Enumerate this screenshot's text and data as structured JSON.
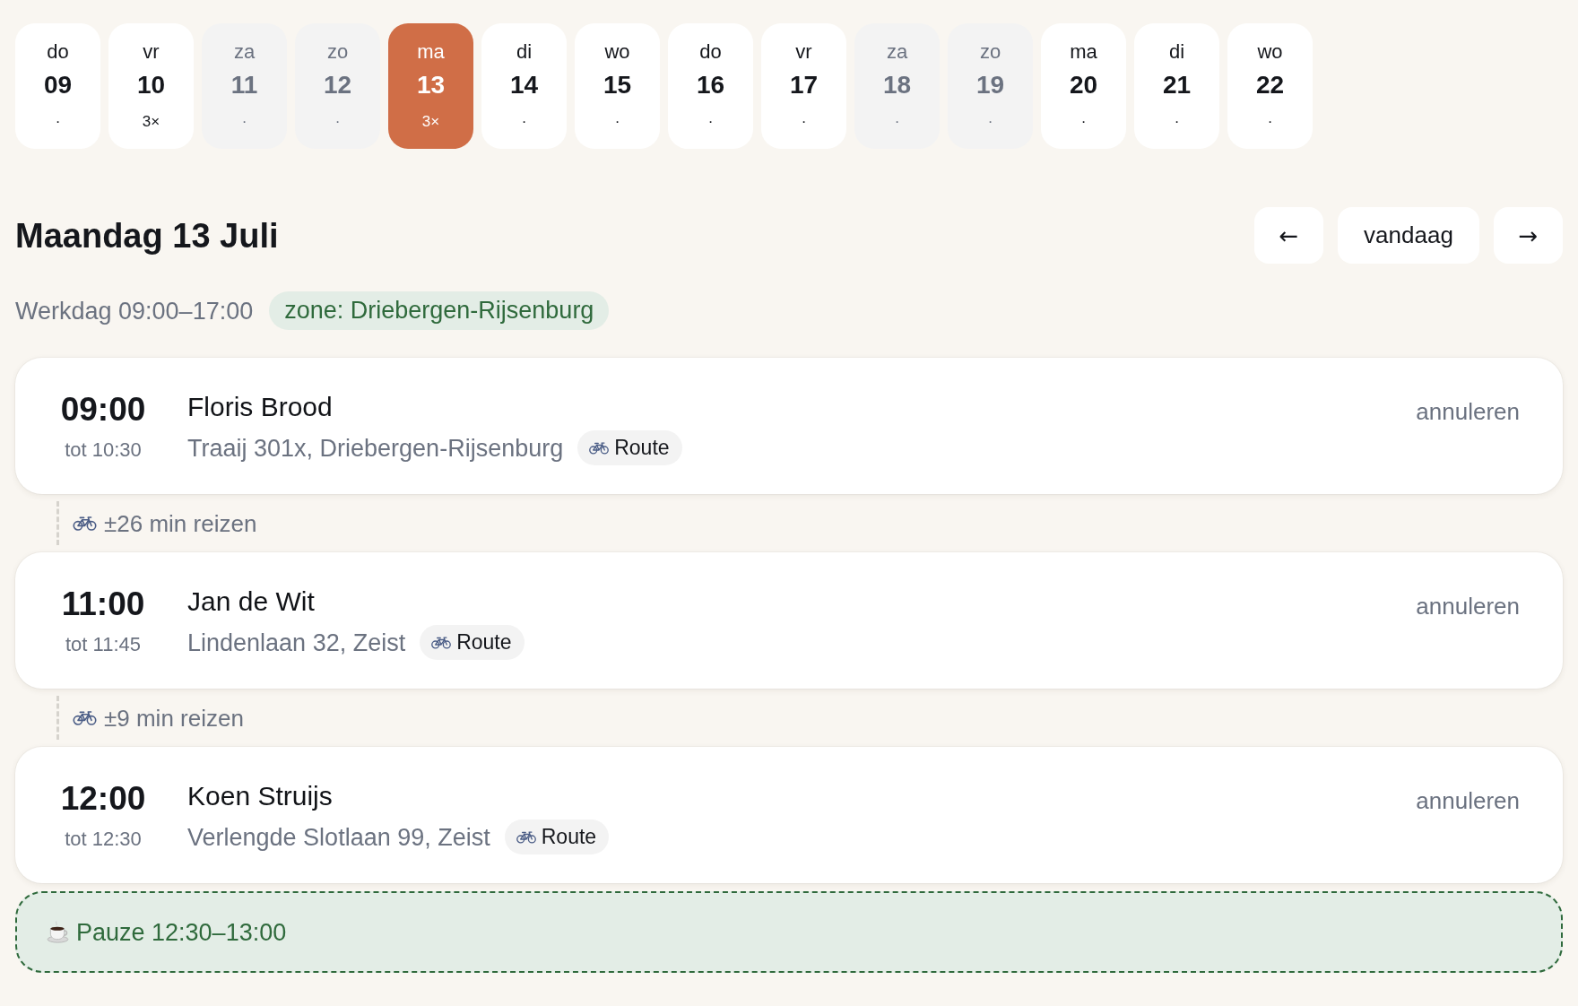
{
  "days": [
    {
      "weekday": "do",
      "date": "09",
      "count": "·",
      "selected": false,
      "weekend": false
    },
    {
      "weekday": "vr",
      "date": "10",
      "count": "3×",
      "selected": false,
      "weekend": false
    },
    {
      "weekday": "za",
      "date": "11",
      "count": "·",
      "selected": false,
      "weekend": true
    },
    {
      "weekday": "zo",
      "date": "12",
      "count": "·",
      "selected": false,
      "weekend": true
    },
    {
      "weekday": "ma",
      "date": "13",
      "count": "3×",
      "selected": true,
      "weekend": false
    },
    {
      "weekday": "di",
      "date": "14",
      "count": "·",
      "selected": false,
      "weekend": false
    },
    {
      "weekday": "wo",
      "date": "15",
      "count": "·",
      "selected": false,
      "weekend": false
    },
    {
      "weekday": "do",
      "date": "16",
      "count": "·",
      "selected": false,
      "weekend": false
    },
    {
      "weekday": "vr",
      "date": "17",
      "count": "·",
      "selected": false,
      "weekend": false
    },
    {
      "weekday": "za",
      "date": "18",
      "count": "·",
      "selected": false,
      "weekend": true
    },
    {
      "weekday": "zo",
      "date": "19",
      "count": "·",
      "selected": false,
      "weekend": true
    },
    {
      "weekday": "ma",
      "date": "20",
      "count": "·",
      "selected": false,
      "weekend": false
    },
    {
      "weekday": "di",
      "date": "21",
      "count": "·",
      "selected": false,
      "weekend": false
    },
    {
      "weekday": "wo",
      "date": "22",
      "count": "·",
      "selected": false,
      "weekend": false
    }
  ],
  "header": {
    "title": "Maandag 13 Juli",
    "nav": {
      "previous": "←",
      "today": "vandaag",
      "next": "→"
    }
  },
  "workday": {
    "hours": "Werkdag 09:00–17:00",
    "zone": "zone: Driebergen-Rijsenburg"
  },
  "schedule": [
    {
      "kind": "appointment",
      "time": "09:00",
      "until": "tot 10:30",
      "name": "Floris Brood",
      "address": "Traaij 301x, Driebergen-Rijsenburg",
      "route": "Route",
      "cancel": "annuleren"
    },
    {
      "kind": "travel",
      "text": "±26 min reizen"
    },
    {
      "kind": "appointment",
      "time": "11:00",
      "until": "tot 11:45",
      "name": "Jan de Wit",
      "address": "Lindenlaan 32, Zeist",
      "route": "Route",
      "cancel": "annuleren"
    },
    {
      "kind": "travel",
      "text": "±9 min reizen"
    },
    {
      "kind": "appointment",
      "time": "12:00",
      "until": "tot 12:30",
      "name": "Koen Struijs",
      "address": "Verlengde Slotlaan 99, Zeist",
      "route": "Route",
      "cancel": "annuleren"
    },
    {
      "kind": "break",
      "text": "Pauze 12:30–13:00"
    }
  ]
}
